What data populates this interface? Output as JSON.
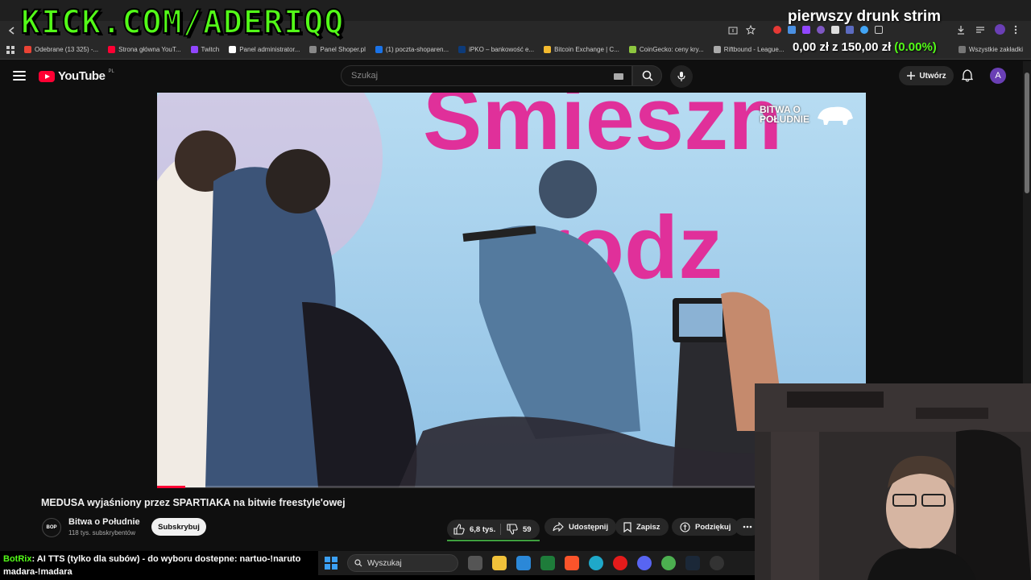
{
  "stream_overlay": {
    "kick_text": "KICK.COM/ADERIQQ",
    "title": "pierwszy drunk strim",
    "balance_start": "0,00 zł",
    "balance_mid": "z",
    "balance_goal": "150,00 zł",
    "balance_percent": "(0.00%)"
  },
  "bookmarks": [
    {
      "label": "Odebrane (13 325) -...",
      "color": "#ea4335"
    },
    {
      "label": "Strona główna YouT...",
      "color": "#ff0033"
    },
    {
      "label": "Twitch",
      "color": "#9146ff"
    },
    {
      "label": "Panel administrator...",
      "color": "#ffffff"
    },
    {
      "label": "Panel Shoper.pl",
      "color": "#888888"
    },
    {
      "label": "(1) poczta-shoparen...",
      "color": "#1a73e8"
    },
    {
      "label": "iPKO – bankowość e...",
      "color": "#0d3b7a"
    },
    {
      "label": "Bitcoin Exchange | C...",
      "color": "#f3ba2f"
    },
    {
      "label": "CoinGecko: ceny kry...",
      "color": "#8dc63f"
    },
    {
      "label": "Riftbound - League...",
      "color": "#aaaaaa"
    },
    {
      "label": "Wszystkie zakładki",
      "color": "#777777"
    }
  ],
  "youtube": {
    "logo_text": "YouTube",
    "region": "PL",
    "search_placeholder": "Szukaj",
    "create_label": "Utwórz",
    "avatar_letter": "A",
    "progress_fraction": 0.04
  },
  "video_overlay": {
    "brand_line1": "BITWA O",
    "brand_line2": "POŁUDNIE",
    "slogan": "Śmieszn",
    "slogan2": "rodz"
  },
  "video": {
    "title": "MEDUSA wyjaśniony przez SPARTIAKA na bitwie freestyle'owej",
    "channel_name": "Bitwa o Południe",
    "channel_avatar_text": "BOP",
    "channel_subs": "118 tys. subskrybentów",
    "subscribe_label": "Subskrybuj",
    "likes": "6,8 tys.",
    "dislikes": "59",
    "share_label": "Udostępnij",
    "save_label": "Zapisz",
    "thanks_label": "Podziękuj"
  },
  "chat": {
    "bot_name": "BotRix",
    "message": ": AI TTS (tylko dla subów) - do wyboru dostepne: nartuo-!naruto madara-!madara"
  },
  "taskbar": {
    "search_label": "Wyszukaj"
  }
}
